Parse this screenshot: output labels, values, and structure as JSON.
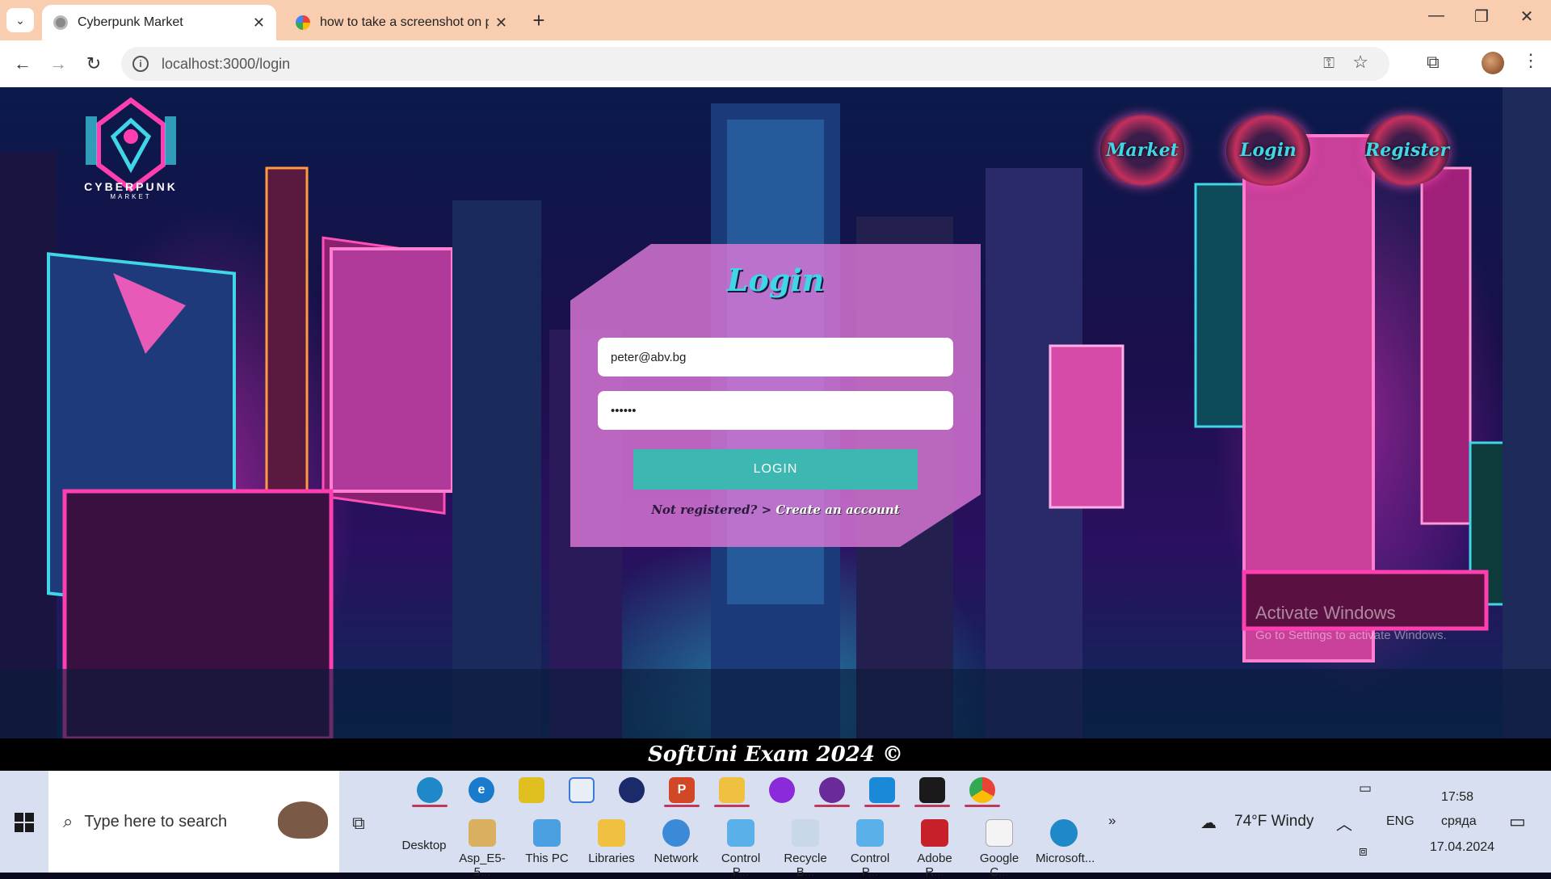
{
  "browser": {
    "tabs": [
      {
        "title": "Cyberpunk Market",
        "active": true
      },
      {
        "title": "how to take a screenshot on pc",
        "active": false
      }
    ],
    "url": "localhost:3000/login"
  },
  "page": {
    "logo": {
      "title": "CYBERPUNK",
      "subtitle": "MARKET"
    },
    "nav": {
      "market": "Market",
      "login": "Login",
      "register": "Register"
    },
    "form": {
      "title": "Login",
      "email_value": "peter@abv.bg",
      "password_value": "••••••",
      "submit_label": "LOGIN",
      "register_prompt": "Not registered?",
      "register_link": "Create an account"
    },
    "watermark": {
      "title": "Activate Windows",
      "subtitle": "Go to Settings to activate Windows."
    },
    "footer": "SoftUni Exam 2024 ©"
  },
  "taskbar": {
    "search_placeholder": "Type here to search",
    "desktop_label": "Desktop",
    "desktop_items": [
      "Asp_E5-5...",
      "This PC",
      "Libraries",
      "Network",
      "Control P...",
      "Recycle B...",
      "Control P...",
      "Adobe R...",
      "Google C...",
      "Microsoft..."
    ],
    "more": "»",
    "weather": "74°F  Windy",
    "language": "ENG",
    "time": "17:58",
    "day": "сряда",
    "date": "17.04.2024"
  },
  "colors": {
    "accent": "#3cb7b2",
    "card": "#dc78d7",
    "brand_cyan": "#3fd6e8",
    "tabbar": "#f8cdb0"
  }
}
